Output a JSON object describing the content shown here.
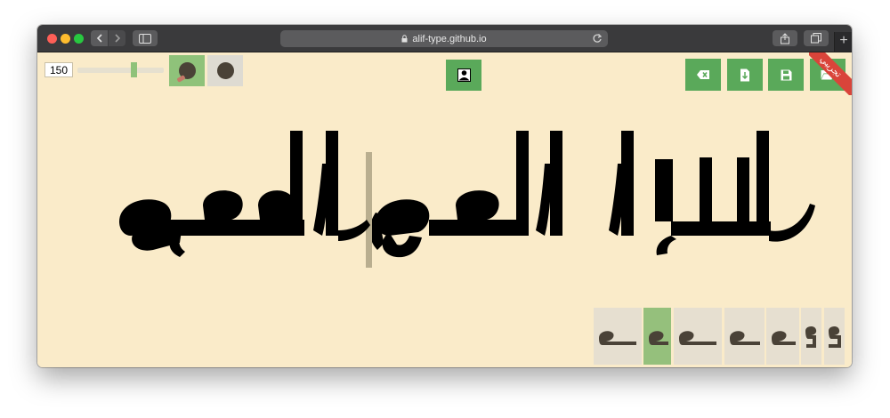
{
  "browser": {
    "url": "alif-type.github.io"
  },
  "toolbar": {
    "size_value": "150",
    "slider_fraction": 0.67
  },
  "ribbon": {
    "label": "تجريبي"
  },
  "colors": {
    "page_bg": "#faebc9",
    "accent_green": "#5aa95a",
    "selected_green": "#95c07c",
    "ribbon_red": "#d9443a",
    "cursor": "#b9ae8f",
    "ink": "#000000"
  },
  "icons": [
    "brush-icon",
    "circle-icon",
    "person-icon",
    "clear-icon",
    "download-icon",
    "save-icon",
    "folder-open-icon"
  ],
  "alternates": {
    "count": 7,
    "selected_index": 1
  }
}
